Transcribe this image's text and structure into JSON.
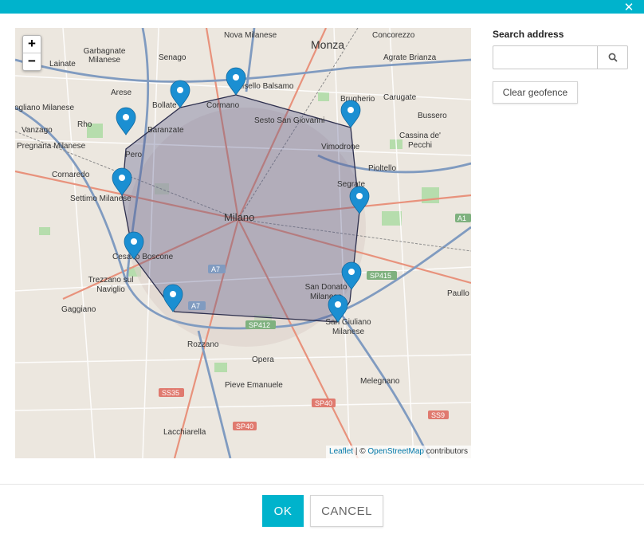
{
  "dialog": {
    "close_icon": "close-icon",
    "ok_label": "OK",
    "cancel_label": "CANCEL"
  },
  "colors": {
    "accent": "#00b3cc",
    "marker": "#1b8fd2",
    "geofence_fill": "#4a4f86",
    "geofence_stroke": "#2d2f4d"
  },
  "map": {
    "zoom_in": "+",
    "zoom_out": "−",
    "attribution": {
      "leaflet": "Leaflet",
      "separator": " | © ",
      "osm": "OpenStreetMap",
      "suffix": " contributors"
    },
    "place_labels": [
      "Nova Milanese",
      "Monza",
      "Concorezzo",
      "Garbagnate Milanese",
      "Senago",
      "Agrate Brianza",
      "Lainate",
      "Arese",
      "Bollate",
      "Cinisello Balsamo",
      "Cormano",
      "Brugherio",
      "Carugate",
      "Bussero",
      "Sesto San Giovanni",
      "Rho",
      "Baranzate",
      "Vimodrone",
      "Cassina de' Pecchi",
      "Vanzago",
      "Pregnana Milanese",
      "Pero",
      "Pioltello",
      "Cornaredo",
      "Segrate",
      "Settimo Milanese",
      "Milano",
      "Cesano Boscone",
      "Trezzano sul Naviglio",
      "San Donato Milanese",
      "Paullo",
      "Gaggiano",
      "San Giuliano Milanese",
      "Rozzano",
      "Opera",
      "Pieve Emanuele",
      "Melegnano",
      "Lacchiarella",
      "ogliano Milanese"
    ],
    "road_labels": [
      "A7",
      "A7",
      "SP412",
      "SP415",
      "SS35",
      "SP40",
      "SP40",
      "SS9",
      "A1"
    ],
    "geofence_markers": 10
  },
  "sidebar": {
    "search_title": "Search address",
    "search_value": "",
    "search_placeholder": "",
    "search_icon": "search-icon",
    "clear_label": "Clear geofence"
  }
}
